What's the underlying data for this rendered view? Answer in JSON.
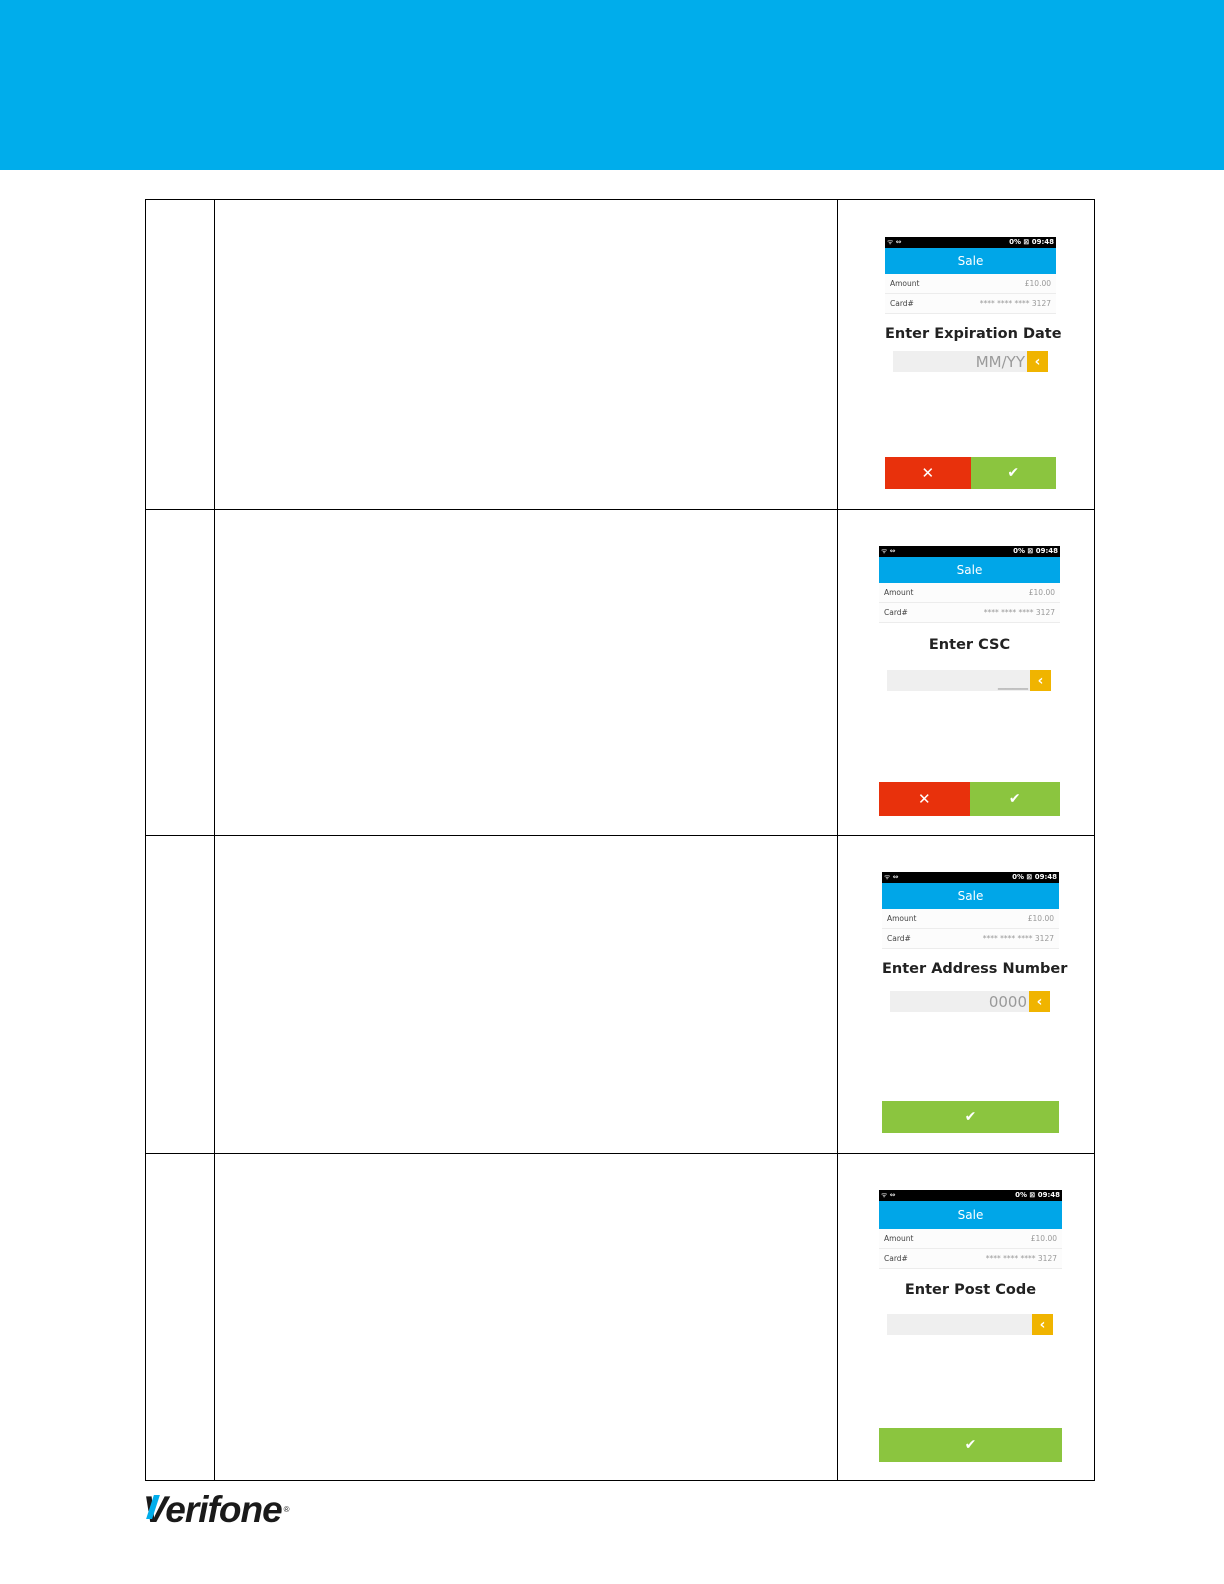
{
  "brand": {
    "logo_text": "Verifone",
    "registered_mark": "®"
  },
  "colors": {
    "header": "#00adeb",
    "title_bar": "#00a6e8",
    "cancel": "#e8310c",
    "confirm": "#8bc53f",
    "backspace": "#f0b400"
  },
  "screens": [
    {
      "status_left": "ᯤ ⇔",
      "status_right": "0% ⊠ 09:48",
      "title": "Sale",
      "amount_label": "Amount",
      "amount_value": "£10.00",
      "card_label": "Card#",
      "card_value": "**** **** **** 3127",
      "prompt": "Enter Expiration Date",
      "placeholder": "MM/YY",
      "backspace_icon": "chevron-left",
      "cancel_icon": "x-mark",
      "confirm_icon": "check-mark",
      "has_cancel": true
    },
    {
      "status_left": "ᯤ ⇔",
      "status_right": "0% ⊠ 09:48",
      "title": "Sale",
      "amount_label": "Amount",
      "amount_value": "£10.00",
      "card_label": "Card#",
      "card_value": "**** **** **** 3127",
      "prompt": "Enter CSC",
      "placeholder": "____",
      "backspace_icon": "chevron-left",
      "cancel_icon": "x-mark",
      "confirm_icon": "check-mark",
      "has_cancel": true
    },
    {
      "status_left": "ᯤ ⇔",
      "status_right": "0% ⊠ 09:48",
      "title": "Sale",
      "amount_label": "Amount",
      "amount_value": "£10.00",
      "card_label": "Card#",
      "card_value": "**** **** **** 3127",
      "prompt": "Enter Address Number",
      "placeholder": "0000",
      "backspace_icon": "chevron-left",
      "confirm_icon": "check-mark",
      "has_cancel": false
    },
    {
      "status_left": "ᯤ ⇔",
      "status_right": "0% ⊠ 09:48",
      "title": "Sale",
      "amount_label": "Amount",
      "amount_value": "£10.00",
      "card_label": "Card#",
      "card_value": "**** **** **** 3127",
      "prompt": "Enter Post Code",
      "placeholder": "",
      "backspace_icon": "chevron-left",
      "confirm_icon": "check-mark",
      "has_cancel": false
    }
  ]
}
